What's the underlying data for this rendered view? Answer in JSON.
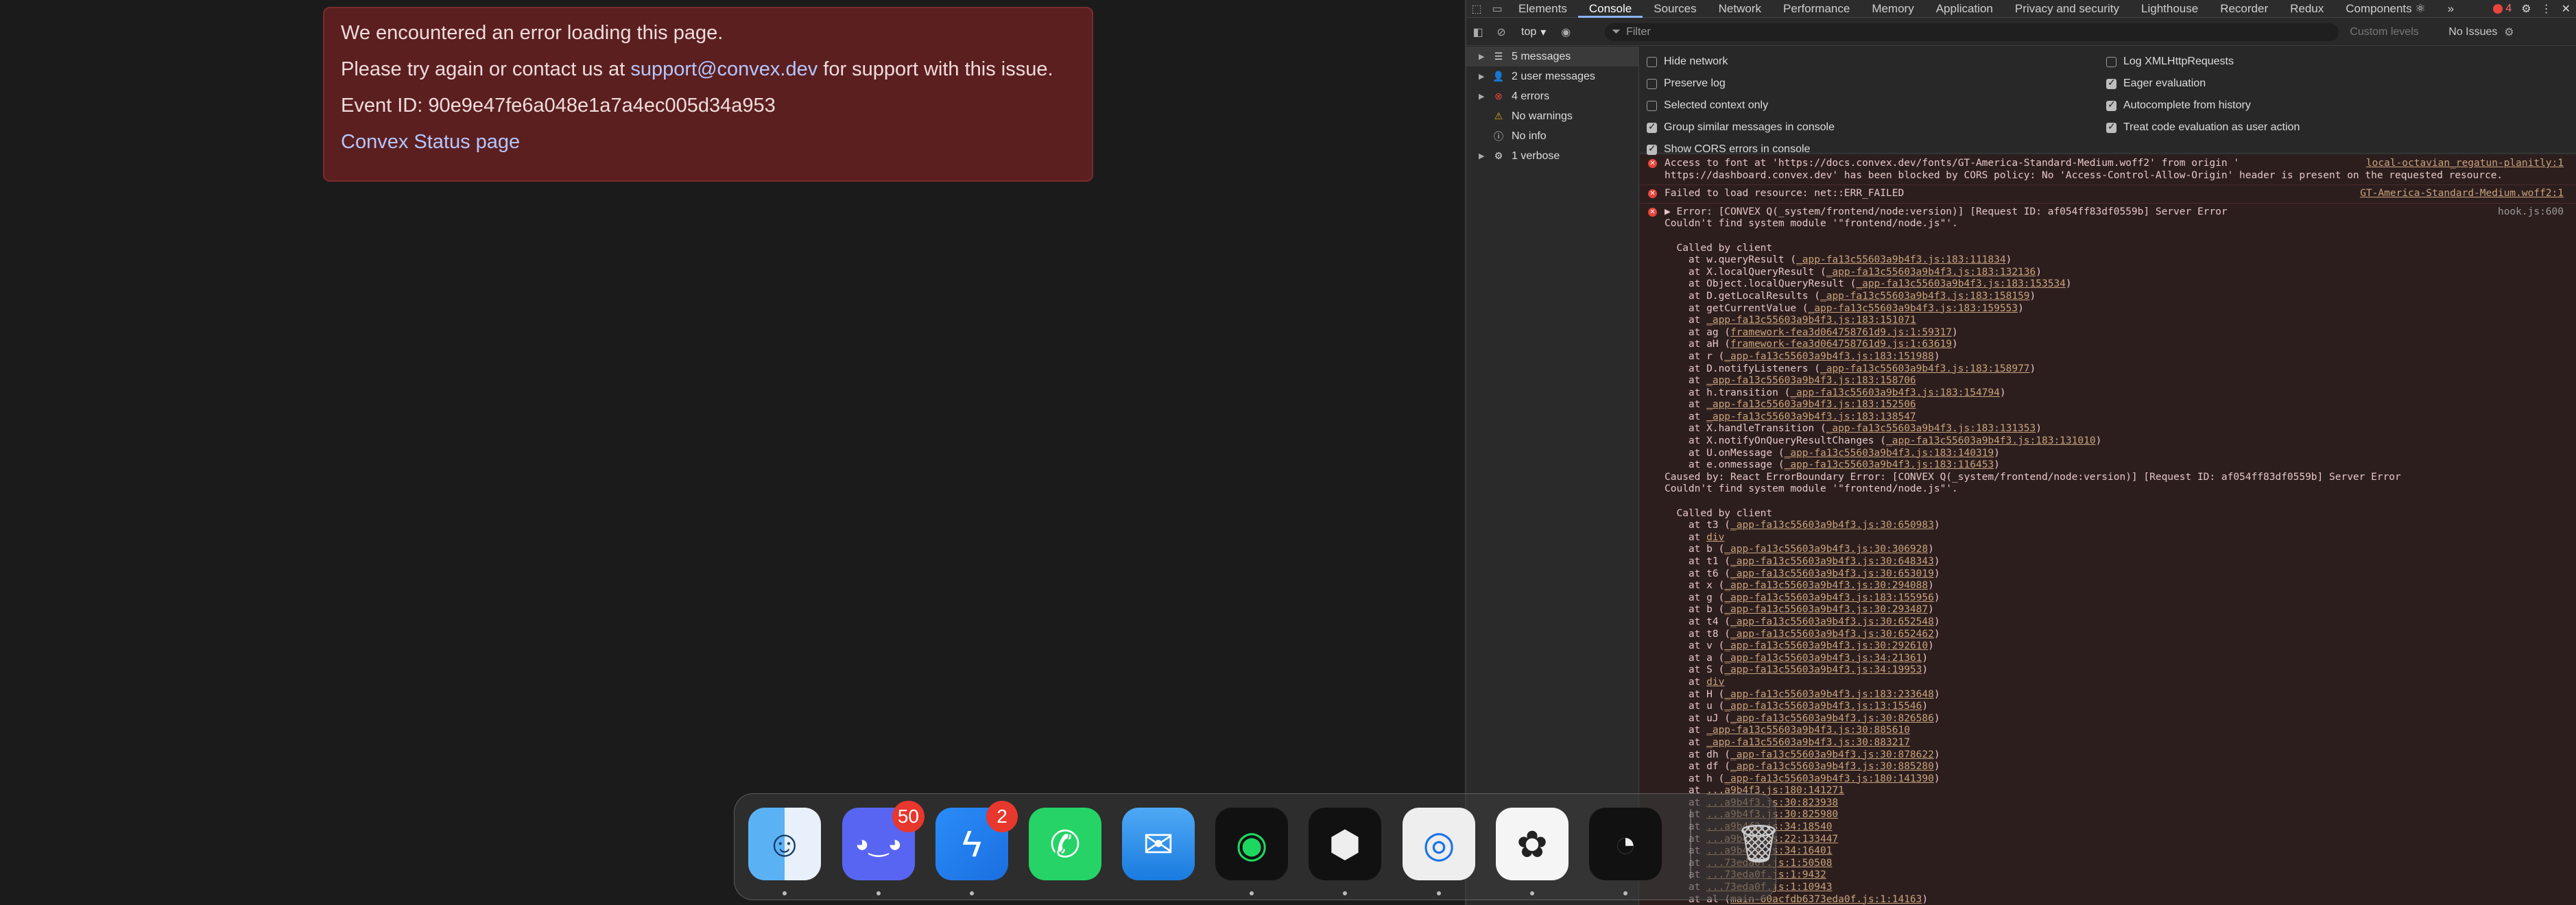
{
  "error_page": {
    "line1": "We encountered an error loading this page.",
    "line2_prefix": "Please try again or contact us at ",
    "support_email": "support@convex.dev",
    "line2_suffix": " for support with this issue.",
    "event_id": "Event ID: 90e9e47fe6a048e1a7a4ec005d34a953",
    "status_link": "Convex Status page"
  },
  "devtools": {
    "tabs": [
      "Elements",
      "Console",
      "Sources",
      "Network",
      "Performance",
      "Memory",
      "Application",
      "Privacy and security",
      "Lighthouse",
      "Recorder",
      "Redux",
      "Components ⚛"
    ],
    "active_tab": "Console",
    "more_tabs": "»",
    "error_count": "4",
    "toolbar": {
      "context": "top",
      "filter_placeholder": "Filter",
      "levels": "Custom levels",
      "issues": "No Issues"
    },
    "sidebar": [
      {
        "label": "5 messages",
        "icon": "list-icon"
      },
      {
        "label": "2 user messages",
        "icon": "user-icon"
      },
      {
        "label": "4 errors",
        "icon": "error-icon"
      },
      {
        "label": "No warnings",
        "icon": "warning-icon"
      },
      {
        "label": "No info",
        "icon": "info-icon"
      },
      {
        "label": "1 verbose",
        "icon": "verbose-icon"
      }
    ],
    "settings_left": [
      {
        "label": "Hide network",
        "checked": false
      },
      {
        "label": "Preserve log",
        "checked": false
      },
      {
        "label": "Selected context only",
        "checked": false
      },
      {
        "label": "Group similar messages in console",
        "checked": true
      },
      {
        "label": "Show CORS errors in console",
        "checked": true
      }
    ],
    "settings_right": [
      {
        "label": "Log XMLHttpRequests",
        "checked": false
      },
      {
        "label": "Eager evaluation",
        "checked": true
      },
      {
        "label": "Autocomplete from history",
        "checked": true
      },
      {
        "label": "Treat code evaluation as user action",
        "checked": true
      }
    ],
    "console": {
      "cors_msg_1": "Access to font at 'https://docs.convex.dev/fonts/GT-America-Standard-Medium.woff2' from origin '",
      "cors_msg_2": "https://dashboard.convex.dev' has been blocked by CORS policy: No 'Access-Control-Allow-Origin' header is present on the requested resource.",
      "cors_src": "local-octavian_regatun-planitly:1",
      "failed_msg": "Failed to load resource: net::ERR_FAILED",
      "failed_src": "GT-America-Standard-Medium.woff2:1",
      "error_head": "▶ Error: [CONVEX Q(_system/frontend/node:version)] [Request ID: af054ff83df0559b] Server Error",
      "error_sub": "Couldn't find system module '\"frontend/node.js\"'.",
      "error_src": "hook.js:600",
      "called_by": "  Called by client",
      "stack1": [
        [
          "    at w.queryResult (",
          "_app-fa13c55603a9b4f3.js:183:111834",
          ")"
        ],
        [
          "    at X.localQueryResult (",
          "_app-fa13c55603a9b4f3.js:183:132136",
          ")"
        ],
        [
          "    at Object.localQueryResult (",
          "_app-fa13c55603a9b4f3.js:183:153534",
          ")"
        ],
        [
          "    at D.getLocalResults (",
          "_app-fa13c55603a9b4f3.js:183:158159",
          ")"
        ],
        [
          "    at getCurrentValue (",
          "_app-fa13c55603a9b4f3.js:183:159553",
          ")"
        ],
        [
          "    at ",
          "_app-fa13c55603a9b4f3.js:183:151071",
          ""
        ],
        [
          "    at ag (",
          "framework-fea3d064758761d9.js:1:59317",
          ")"
        ],
        [
          "    at aH (",
          "framework-fea3d064758761d9.js:1:63619",
          ")"
        ],
        [
          "    at r (",
          "_app-fa13c55603a9b4f3.js:183:151988",
          ")"
        ],
        [
          "    at D.notifyListeners (",
          "_app-fa13c55603a9b4f3.js:183:158977",
          ")"
        ],
        [
          "    at ",
          "_app-fa13c55603a9b4f3.js:183:158706",
          ""
        ],
        [
          "    at h.transition (",
          "_app-fa13c55603a9b4f3.js:183:154794",
          ")"
        ],
        [
          "    at ",
          "_app-fa13c55603a9b4f3.js:183:152506",
          ""
        ],
        [
          "    at ",
          "_app-fa13c55603a9b4f3.js:183:138547",
          ""
        ],
        [
          "    at X.handleTransition (",
          "_app-fa13c55603a9b4f3.js:183:131353",
          ")"
        ],
        [
          "    at X.notifyOnQueryResultChanges (",
          "_app-fa13c55603a9b4f3.js:183:131010",
          ")"
        ],
        [
          "    at U.onMessage (",
          "_app-fa13c55603a9b4f3.js:183:140319",
          ")"
        ],
        [
          "    at e.onmessage (",
          "_app-fa13c55603a9b4f3.js:183:116453",
          ")"
        ]
      ],
      "caused_by": "Caused by: React ErrorBoundary Error: [CONVEX Q(_system/frontend/node:version)] [Request ID: af054ff83df0559b] Server Error",
      "caused_sub": "Couldn't find system module '\"frontend/node.js\"'.",
      "stack2": [
        [
          "    at t3 (",
          "_app-fa13c55603a9b4f3.js:30:650983",
          ")"
        ],
        [
          "    at ",
          "div",
          ""
        ],
        [
          "    at b (",
          "_app-fa13c55603a9b4f3.js:30:306928",
          ")"
        ],
        [
          "    at t1 (",
          "_app-fa13c55603a9b4f3.js:30:648343",
          ")"
        ],
        [
          "    at t6 (",
          "_app-fa13c55603a9b4f3.js:30:653019",
          ")"
        ],
        [
          "    at x (",
          "_app-fa13c55603a9b4f3.js:30:294088",
          ")"
        ],
        [
          "    at g (",
          "_app-fa13c55603a9b4f3.js:183:155956",
          ")"
        ],
        [
          "    at b (",
          "_app-fa13c55603a9b4f3.js:30:293487",
          ")"
        ],
        [
          "    at t4 (",
          "_app-fa13c55603a9b4f3.js:30:652548",
          ")"
        ],
        [
          "    at t8 (",
          "_app-fa13c55603a9b4f3.js:30:652462",
          ")"
        ],
        [
          "    at v (",
          "_app-fa13c55603a9b4f3.js:30:292610",
          ")"
        ],
        [
          "    at a (",
          "_app-fa13c55603a9b4f3.js:34:21361",
          ")"
        ],
        [
          "    at S (",
          "_app-fa13c55603a9b4f3.js:34:19953",
          ")"
        ],
        [
          "    at ",
          "div",
          ""
        ],
        [
          "    at H (",
          "_app-fa13c55603a9b4f3.js:183:233648",
          ")"
        ],
        [
          "    at u (",
          "_app-fa13c55603a9b4f3.js:13:15546",
          ")"
        ],
        [
          "    at uJ (",
          "_app-fa13c55603a9b4f3.js:30:826586",
          ")"
        ],
        [
          "    at ",
          "_app-fa13c55603a9b4f3.js:30:885610",
          ""
        ],
        [
          "    at ",
          "_app-fa13c55603a9b4f3.js:30:883217",
          ""
        ],
        [
          "    at dh (",
          "_app-fa13c55603a9b4f3.js:30:878622",
          ")"
        ],
        [
          "    at df (",
          "_app-fa13c55603a9b4f3.js:30:885280",
          ")"
        ],
        [
          "    at h (",
          "_app-fa13c55603a9b4f3.js:180:141390",
          ")"
        ],
        [
          "    at ",
          "...a9b4f3.js:180:141271",
          ""
        ],
        [
          "    at ",
          "...a9b4f3.js:30:823938",
          ""
        ],
        [
          "    at ",
          "...a9b4f3.js:30:825980",
          ""
        ],
        [
          "    at ",
          "...a9b4f3.js:34:18540",
          ""
        ],
        [
          "    at ",
          "...a9b4f3.js:22:133447",
          ""
        ],
        [
          "    at ",
          "...a9b4f3.js:34:16401",
          ""
        ],
        [
          "    at ",
          "...73eda0f.js:1:50508",
          ""
        ],
        [
          "    at ",
          "...73eda0f.js:1:9432",
          ""
        ],
        [
          "    at ",
          "...73eda0f.js:1:10943",
          ""
        ],
        [
          "    at al (",
          "main-60acfdb6373eda0f.js:1:14163",
          ")"
        ]
      ]
    }
  },
  "dock": {
    "apps": [
      {
        "name": "Finder",
        "icon": "finder-icon",
        "badge": "",
        "running": true
      },
      {
        "name": "Discord",
        "icon": "discord-icon",
        "badge": "50",
        "running": true
      },
      {
        "name": "Messenger",
        "icon": "messenger-icon",
        "badge": "2",
        "running": true
      },
      {
        "name": "WhatsApp",
        "icon": "whatsapp-icon",
        "badge": "",
        "running": false
      },
      {
        "name": "Mail",
        "icon": "mail-icon",
        "badge": "",
        "running": false
      },
      {
        "name": "Spotify",
        "icon": "spotify-icon",
        "badge": "",
        "running": true
      },
      {
        "name": "Cube",
        "icon": "cube-icon",
        "badge": "",
        "running": true
      },
      {
        "name": "Chrome",
        "icon": "chrome-icon",
        "badge": "",
        "running": true
      },
      {
        "name": "ChatGPT",
        "icon": "chatgpt-icon",
        "badge": "",
        "running": true
      },
      {
        "name": "Linear",
        "icon": "linear-icon",
        "badge": "",
        "running": true
      },
      {
        "name": "Trash",
        "icon": "trash-icon",
        "badge": "",
        "running": false
      }
    ]
  }
}
